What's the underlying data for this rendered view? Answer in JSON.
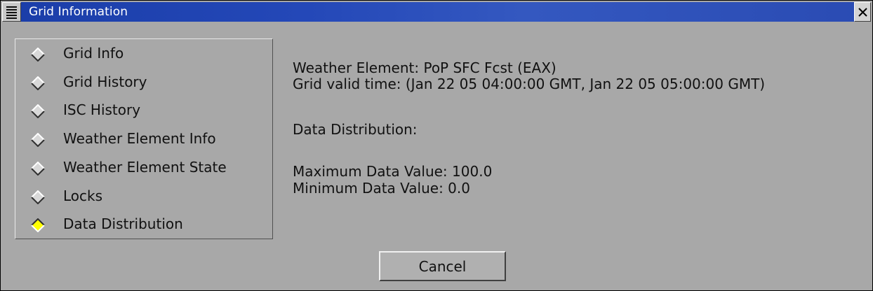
{
  "window": {
    "title": "Grid Information"
  },
  "options": [
    {
      "label": "Grid Info",
      "selected": false
    },
    {
      "label": "Grid History",
      "selected": false
    },
    {
      "label": "ISC History",
      "selected": false
    },
    {
      "label": "Weather Element Info",
      "selected": false
    },
    {
      "label": "Weather Element State",
      "selected": false
    },
    {
      "label": "Locks",
      "selected": false
    },
    {
      "label": "Data Distribution",
      "selected": true
    }
  ],
  "info": {
    "weather_element": "Weather Element: PoP SFC Fcst (EAX)",
    "valid_time": "Grid valid time: (Jan 22 05 04:00:00 GMT, Jan 22 05 05:00:00 GMT)",
    "section_heading": "Data Distribution:",
    "max_value": "Maximum Data Value: 100.0",
    "min_value": "Minimum Data Value: 0.0"
  },
  "buttons": {
    "cancel": "Cancel"
  },
  "colors": {
    "titlebar": "#2448b8",
    "background": "#a8a8a8",
    "selected_indicator": "#ffff00",
    "unselected_indicator": "#d8d8d8"
  },
  "icons": {
    "window_menu": "window-menu-icon",
    "close": "close-icon",
    "radio": "diamond-radio-icon"
  }
}
